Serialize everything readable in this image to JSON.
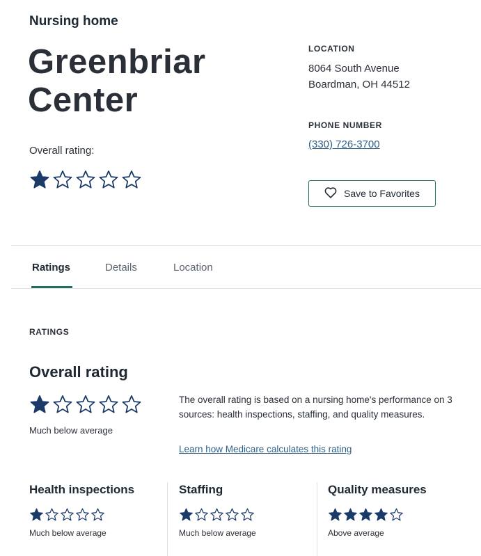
{
  "header": {
    "kicker": "Nursing home",
    "title_line1": "Greenbriar",
    "title_line2": "Center",
    "overall_label": "Overall rating:",
    "overall_stars": 1,
    "max_stars": 5
  },
  "location": {
    "label": "LOCATION",
    "line1": "8064 South Avenue",
    "line2": "Boardman, OH 44512"
  },
  "phone": {
    "label": "PHONE NUMBER",
    "number": "(330) 726-3700"
  },
  "save_button": {
    "label": "Save to Favorites"
  },
  "tabs": [
    {
      "label": "Ratings",
      "active": true
    },
    {
      "label": "Details",
      "active": false
    },
    {
      "label": "Location",
      "active": false
    }
  ],
  "ratings": {
    "section_label": "RATINGS",
    "overall": {
      "title": "Overall rating",
      "stars": 1,
      "caption": "Much below average",
      "description": "The overall rating is based on a nursing home's performance on 3 sources: health inspections, staffing, and quality measures.",
      "link": "Learn how Medicare calculates this rating"
    },
    "components": [
      {
        "title": "Health inspections",
        "stars": 1,
        "caption": "Much below average"
      },
      {
        "title": "Staffing",
        "stars": 1,
        "caption": "Much below average"
      },
      {
        "title": "Quality measures",
        "stars": 4,
        "caption": "Above average"
      }
    ]
  },
  "colors": {
    "star_fill": "#1b3a68",
    "accent": "#1f6f5e",
    "link": "#2e5f86"
  }
}
